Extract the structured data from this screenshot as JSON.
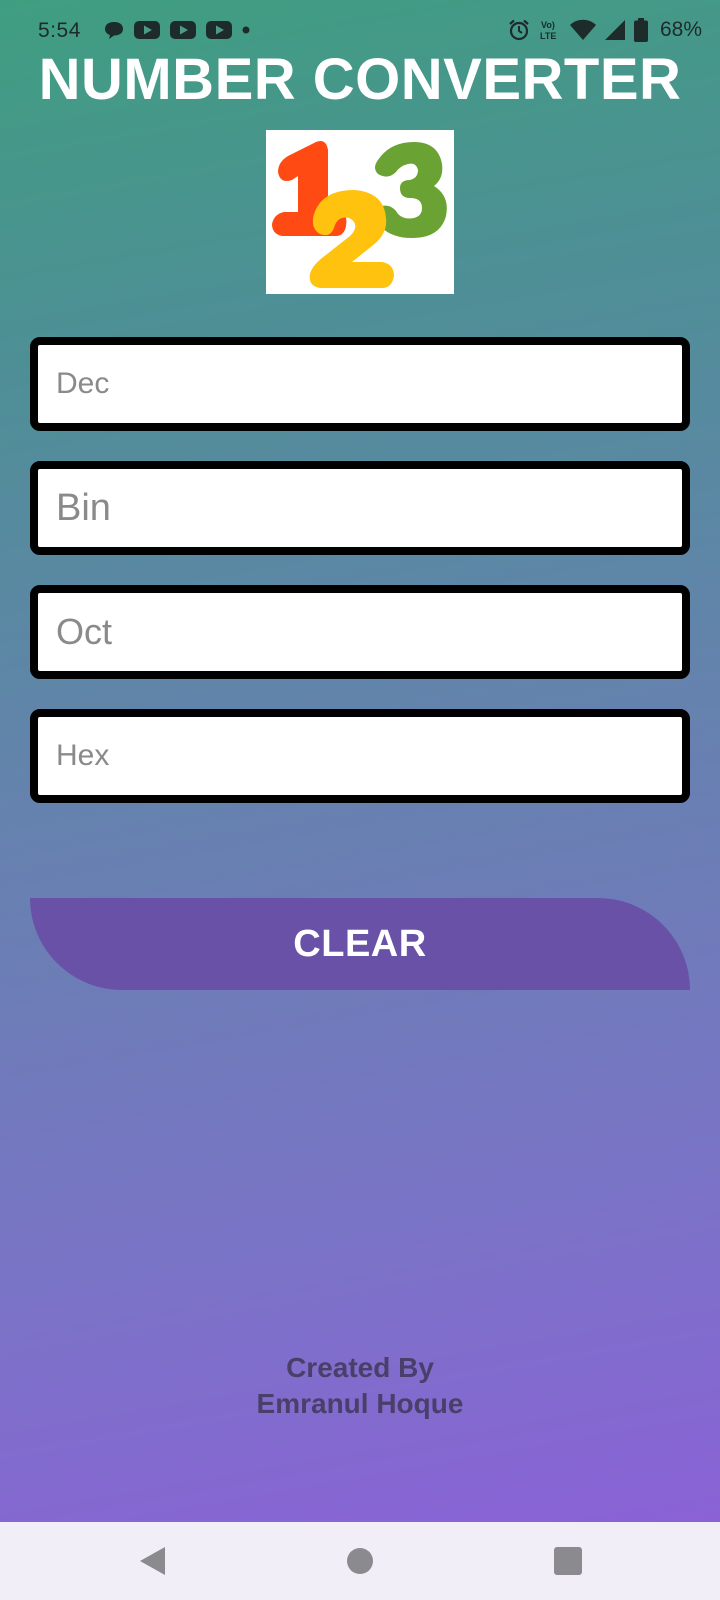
{
  "status_bar": {
    "time": "5:54",
    "notification_icons": [
      "chat-bubble-icon",
      "youtube-icon",
      "youtube-icon",
      "youtube-icon",
      "dot-icon"
    ],
    "system_icons": [
      "alarm-icon",
      "volte-icon",
      "wifi-icon",
      "cell-signal-icon",
      "battery-icon"
    ],
    "battery_percent": "68%"
  },
  "header": {
    "title": "NUMBER CONVERTER"
  },
  "logo": {
    "icon": "numbers-123-logo-icon",
    "colors": [
      "#ff4a14",
      "#ffc20e",
      "#6aa234"
    ]
  },
  "fields": {
    "dec": {
      "placeholder": "Dec",
      "value": ""
    },
    "bin": {
      "placeholder": "Bin",
      "value": ""
    },
    "oct": {
      "placeholder": "Oct",
      "value": ""
    },
    "hex": {
      "placeholder": "Hex",
      "value": ""
    }
  },
  "actions": {
    "clear_label": "CLEAR",
    "clear_color": "#6a51a8"
  },
  "credits": {
    "line1": "Created By",
    "line2": "Emranul Hoque"
  },
  "nav": {
    "icons": [
      "back-icon",
      "home-icon",
      "recents-icon"
    ]
  }
}
